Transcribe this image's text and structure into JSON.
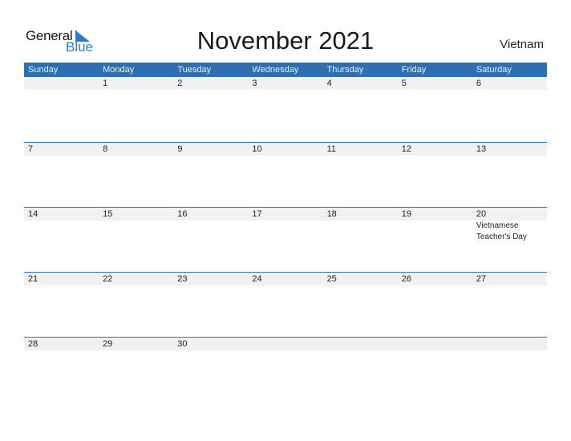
{
  "logo": {
    "general": "General",
    "blue": "Blue"
  },
  "title": "November 2021",
  "country": "Vietnam",
  "weekdays": [
    "Sunday",
    "Monday",
    "Tuesday",
    "Wednesday",
    "Thursday",
    "Friday",
    "Saturday"
  ],
  "weeks": [
    [
      "",
      "1",
      "2",
      "3",
      "4",
      "5",
      "6"
    ],
    [
      "7",
      "8",
      "9",
      "10",
      "11",
      "12",
      "13"
    ],
    [
      "14",
      "15",
      "16",
      "17",
      "18",
      "19",
      "20"
    ],
    [
      "21",
      "22",
      "23",
      "24",
      "25",
      "26",
      "27"
    ],
    [
      "28",
      "29",
      "30",
      "",
      "",
      "",
      ""
    ]
  ],
  "events": [
    {
      "week": 2,
      "day": 6,
      "line1": "Vietnamese",
      "line2": "Teacher's Day"
    }
  ],
  "colors": {
    "header": "#2e6fb2",
    "strip": "#f1f1f1",
    "logo_blue": "#2b7bc9"
  }
}
